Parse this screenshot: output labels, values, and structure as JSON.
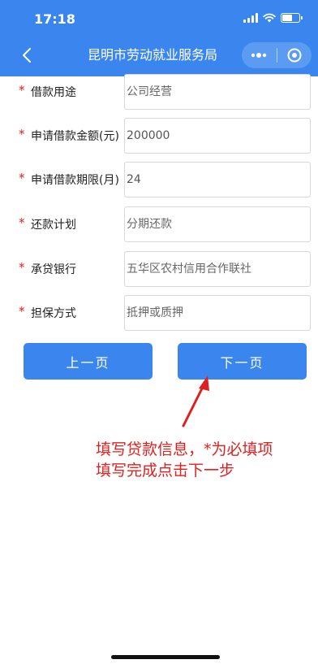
{
  "status_bar": {
    "time": "17:18"
  },
  "nav": {
    "title": "昆明市劳动就业服务局"
  },
  "colors": {
    "primary": "#3a86ee",
    "required": "#e02020",
    "annotation": "#e02020"
  },
  "form": {
    "required_mark": "*",
    "fields": [
      {
        "label": "借款用途",
        "placeholder": "公司经营"
      },
      {
        "label": "申请借款金额(元)",
        "value": "200000"
      },
      {
        "label": "申请借款期限(月)",
        "value": "24"
      },
      {
        "label": "还款计划",
        "placeholder": "分期还款"
      },
      {
        "label": "承贷银行",
        "placeholder": "五华区农村信用合作联社"
      },
      {
        "label": "担保方式",
        "placeholder": "抵押或质押"
      }
    ]
  },
  "buttons": {
    "prev": "上一页",
    "next": "下一页"
  },
  "annotation": {
    "line1": "填写贷款信息，*为必填项",
    "line2": "填写完成点击下一步"
  }
}
